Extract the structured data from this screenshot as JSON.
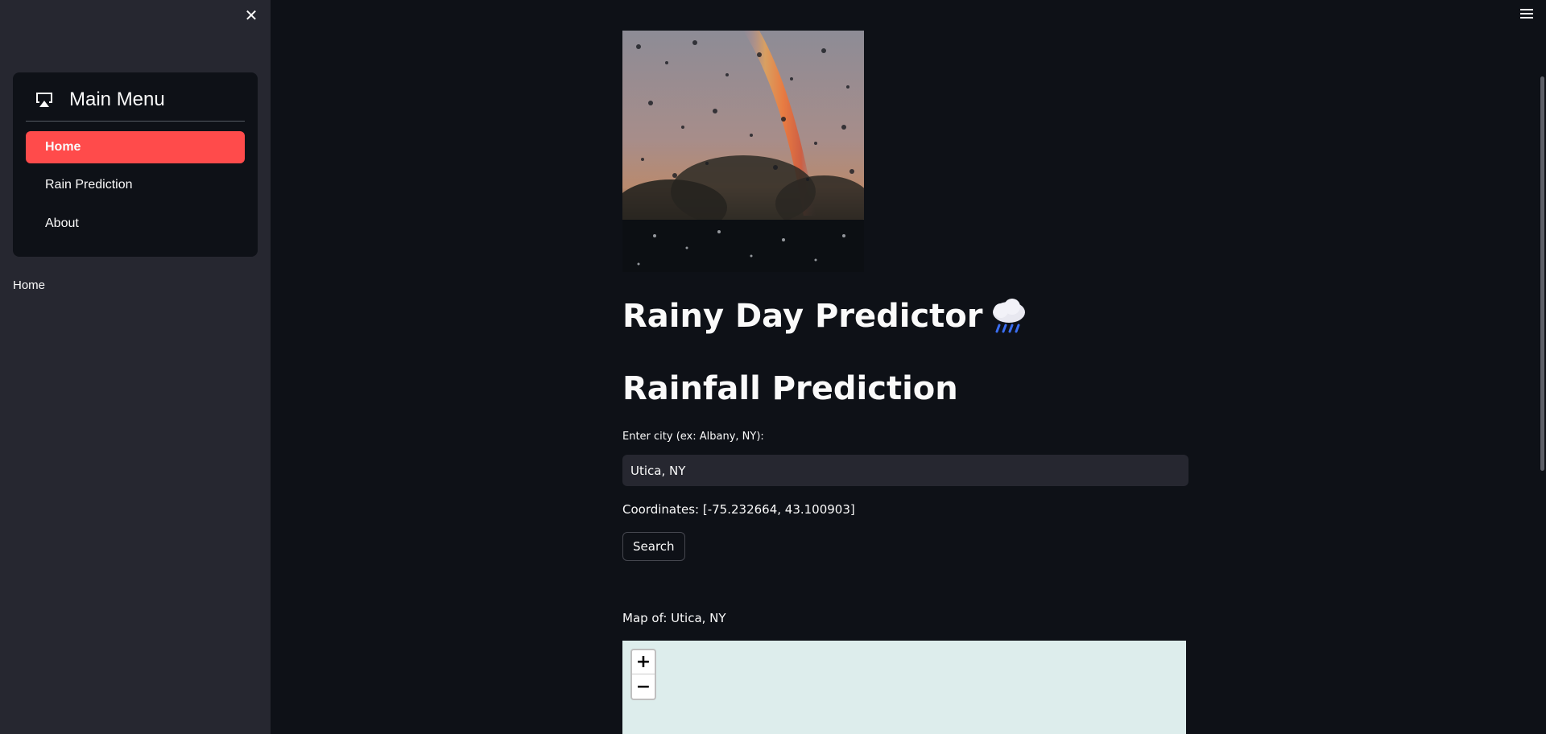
{
  "sidebar": {
    "close_icon": "close-icon",
    "menu": {
      "title": "Main Menu",
      "icon": "airplay-icon",
      "items": [
        {
          "label": "Home",
          "active": true
        },
        {
          "label": "Rain Prediction",
          "active": false
        },
        {
          "label": "About",
          "active": false
        }
      ]
    },
    "selected_text": "Home"
  },
  "header": {
    "menu_icon": "hamburger-icon"
  },
  "main": {
    "image": {
      "description_icon": "rainbow-raindrops-image"
    },
    "title": "Rainy Day Predictor",
    "title_emoji_icon": "cloud-with-rain-icon",
    "subtitle": "Rainfall Prediction",
    "city_input": {
      "label": "Enter city (ex: Albany, NY):",
      "value": "Utica, NY"
    },
    "coordinates_text": "Coordinates: [-75.232664, 43.100903]",
    "search_label": "Search",
    "map_label": "Map of: Utica, NY",
    "map": {
      "zoom_in": "+",
      "zoom_out": "−"
    }
  },
  "colors": {
    "background": "#0e1117",
    "sidebar": "#262730",
    "accent": "#ff4b4b",
    "map_water": "#ddedec"
  }
}
